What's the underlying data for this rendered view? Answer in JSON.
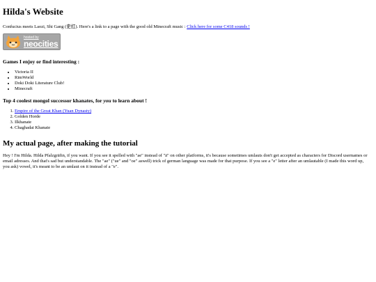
{
  "header": {
    "title": "Hilda's Website"
  },
  "intro": {
    "text": "Confucius meets Laozi, Shi Gang (史扛). Here's a link to a page with the good old Minecraft music : ",
    "link_label": "Click here for some C418 sounds !"
  },
  "badge": {
    "small_text": "hosted by",
    "big_text": "neocities"
  },
  "games": {
    "heading": "Games I enjoy or find interesting :",
    "items": [
      "Victoria II",
      "RimWorld",
      "Doki Doki Literature Club!",
      "Minecraft"
    ]
  },
  "khanates": {
    "heading_before": "Top 4 coolest mongol successor khanates, for ",
    "heading_emphasis": "you",
    "heading_after": " to learn about !",
    "first_link": "Empire of the Great Khan (Yuan Dynasty)",
    "items": [
      "Golden Horde",
      "Ilkhanate",
      "Chaghadai Khanate"
    ]
  },
  "tutorial": {
    "heading": "My actual page, after making the tutorial",
    "text": "Hey ! I'm Hilda. Hilda Pfalzgräfin, if you want. If you see it spelled with \"ae\" instead of \"ä\" on other platforms, it's because sometimes umlauts don't get accepted as characters for Discord usernames or email adresses. And that's sad but understandable. The \"ae\" (\"ue\" and \"oe\" aswell) trick of german language was made for that purpose. If you see a \"e\" letter after an umlautable (I made this word up, you ask) vowel, it's meant to be an umlaut on it instead of a \"e\"."
  }
}
